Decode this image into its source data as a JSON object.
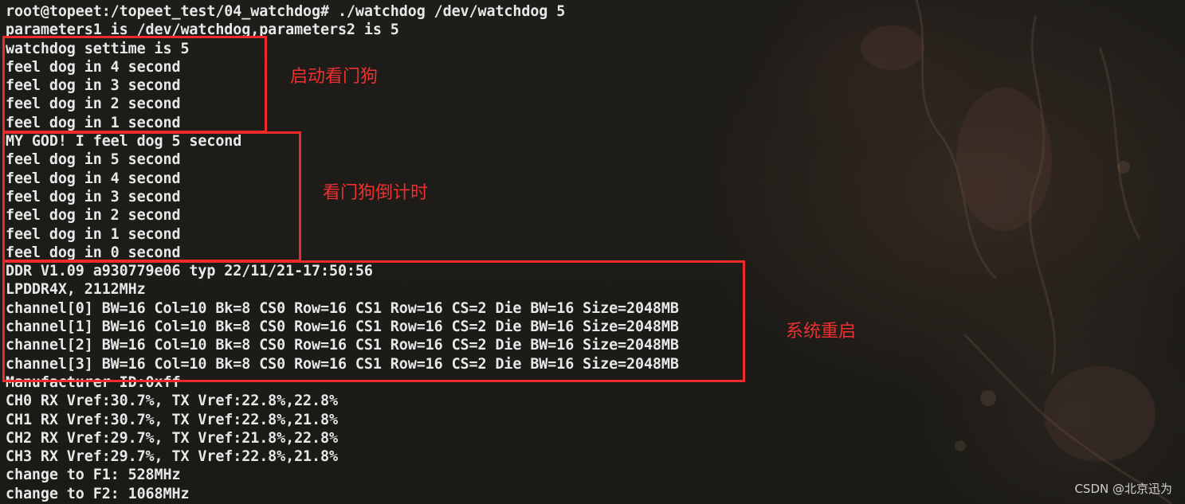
{
  "terminal": {
    "lines": [
      "root@topeet:/topeet_test/04_watchdog# ./watchdog /dev/watchdog 5",
      "parameters1 is /dev/watchdog,parameters2 is 5",
      "watchdog settime is 5",
      "feel dog in 4 second",
      "feel dog in 3 second",
      "feel dog in 2 second",
      "feel dog in 1 second",
      "MY GOD! I feel dog 5 second",
      "feel dog in 5 second",
      "feel dog in 4 second",
      "feel dog in 3 second",
      "feel dog in 2 second",
      "feel dog in 1 second",
      "feel dog in 0 second",
      "DDR V1.09 a930779e06 typ 22/11/21-17:50:56",
      "LPDDR4X, 2112MHz",
      "channel[0] BW=16 Col=10 Bk=8 CS0 Row=16 CS1 Row=16 CS=2 Die BW=16 Size=2048MB",
      "channel[1] BW=16 Col=10 Bk=8 CS0 Row=16 CS1 Row=16 CS=2 Die BW=16 Size=2048MB",
      "channel[2] BW=16 Col=10 Bk=8 CS0 Row=16 CS1 Row=16 CS=2 Die BW=16 Size=2048MB",
      "channel[3] BW=16 Col=10 Bk=8 CS0 Row=16 CS1 Row=16 CS=2 Die BW=16 Size=2048MB",
      "Manufacturer ID:0xff",
      "CH0 RX Vref:30.7%, TX Vref:22.8%,22.8%",
      "CH1 RX Vref:30.7%, TX Vref:22.8%,21.8%",
      "CH2 RX Vref:29.7%, TX Vref:21.8%,22.8%",
      "CH3 RX Vref:29.7%, TX Vref:22.8%,21.8%",
      "change to F1: 528MHz",
      "change to F2: 1068MHz"
    ]
  },
  "annotations": {
    "start_watchdog": "启动看门狗",
    "watchdog_countdown": "看门狗倒计时",
    "system_reboot": "系统重启"
  },
  "colors": {
    "annotation": "#ee2a2a",
    "terminal_text": "#e8e8e8",
    "background": "#1d1b17"
  },
  "watermark": "CSDN @北京迅为"
}
